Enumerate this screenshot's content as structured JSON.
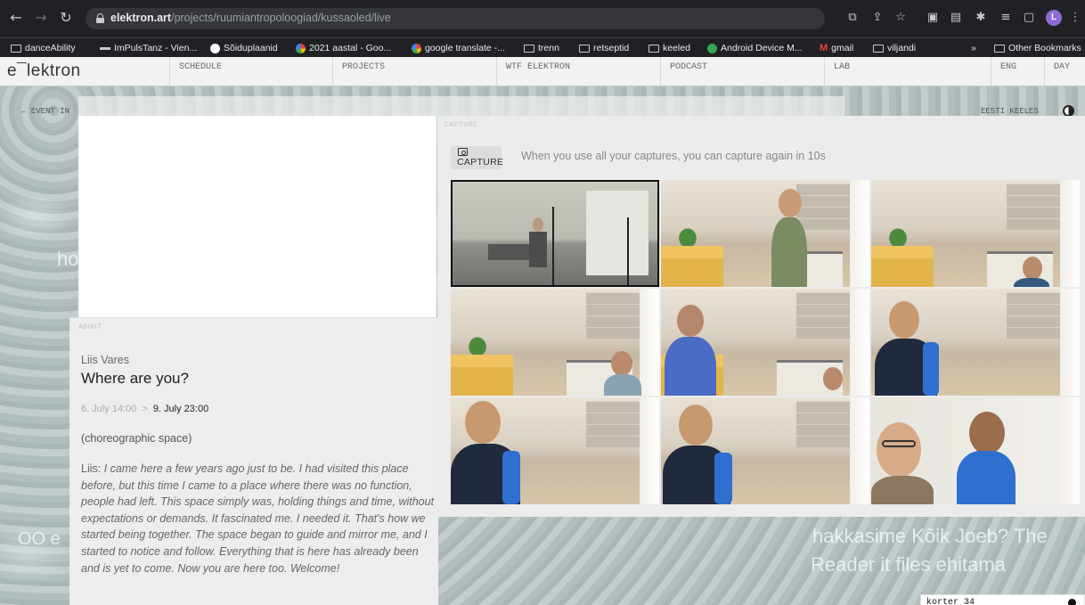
{
  "browser": {
    "url_host": "elektron.art",
    "url_path": "/projects/ruumiantropoloogiad/kussaoled/live",
    "avatar_letter": "L",
    "bookmarks": [
      {
        "label": "danceAbility",
        "icon": "folder-icon"
      },
      {
        "label": "ImPulsTanz - Vien...",
        "icon": "dash-icon"
      },
      {
        "label": "Sõiduplaanid",
        "icon": "bus-icon"
      },
      {
        "label": "2021 aastal - Goo...",
        "icon": "google-icon"
      },
      {
        "label": "google translate -...",
        "icon": "google-icon"
      },
      {
        "label": "trenn",
        "icon": "folder-icon"
      },
      {
        "label": "retseptid",
        "icon": "folder-icon"
      },
      {
        "label": "keeled",
        "icon": "folder-icon"
      },
      {
        "label": "Android Device M...",
        "icon": "android-icon"
      },
      {
        "label": "gmail",
        "icon": "gmail-icon"
      },
      {
        "label": "viljandi",
        "icon": "folder-icon"
      }
    ],
    "overflow_label": "»",
    "other_bookmarks": "Other Bookmarks"
  },
  "site": {
    "logo": "e¯lektron",
    "nav": [
      "SCHEDULE",
      "PROJECTS",
      "WTF ELEKTRON",
      "PODCAST",
      "LAB",
      "ENG",
      "DAY"
    ],
    "back_link": "← EVENT IN",
    "lang_link": "EESTI KEELES",
    "bg_fragment_left": "ho",
    "bg_fragment_left2": "OO e",
    "bg_text_line1": "hakkasime Kõik Joeb? The",
    "bg_text_line2": "Reader it files ehitama"
  },
  "about": {
    "section_label": "ABOUT",
    "artist": "Liis Vares",
    "title": "Where are you?",
    "date_start": "6. July 14:00",
    "date_sep": ">",
    "date_end": "9. July 23:00",
    "category": "(choreographic space)",
    "speaker": "Liis: ",
    "quote": "I came here a few years ago just to be. I had visited this place before, but this time I came to a place where there was no function, people had left. This space simply was, holding things and time, without expectations or demands. It fascinated me. I needed it. That's how we started being together. The space began to guide and mirror me, and I started to notice and follow. Everything that is here has already been and is yet to come. Now you are here too. Welcome!"
  },
  "capture": {
    "section_label": "CAPTURE",
    "button_label": "CAPTURE",
    "hint": "When you use all your captures, you can capture again in 10s"
  },
  "footer": {
    "badge_label": "korter 34"
  }
}
